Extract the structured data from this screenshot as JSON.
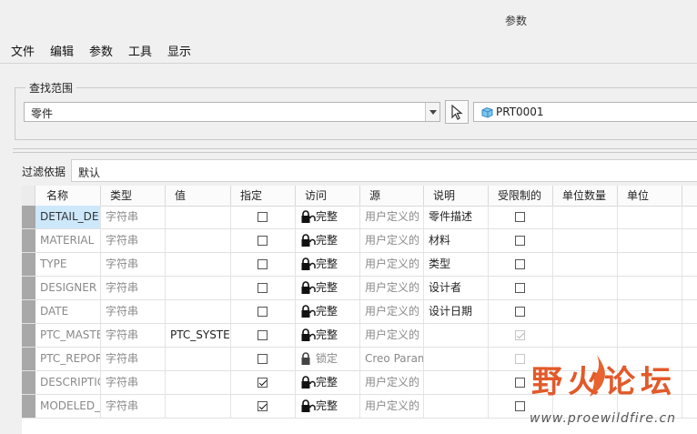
{
  "window": {
    "title": "参数"
  },
  "menu": [
    "文件",
    "编辑",
    "参数",
    "工具",
    "显示"
  ],
  "scope": {
    "group_label": "查找范围",
    "scope_value": "零件",
    "part_value": "PRT0001"
  },
  "filter": {
    "label": "过滤依据",
    "value": "默认"
  },
  "columns": [
    "名称",
    "类型",
    "值",
    "指定",
    "访问",
    "源",
    "说明",
    "受限制的",
    "单位数量",
    "单位"
  ],
  "rows": [
    {
      "name": "DETAIL_DE",
      "type": "字符串",
      "value": "",
      "designated": false,
      "access": "完整",
      "source": "用户定义的",
      "desc": "零件描述",
      "restricted": false,
      "restricted_disabled": false,
      "selected": true
    },
    {
      "name": "MATERIAL",
      "type": "字符串",
      "value": "",
      "designated": false,
      "access": "完整",
      "source": "用户定义的",
      "desc": "材料",
      "restricted": false,
      "restricted_disabled": false
    },
    {
      "name": "TYPE",
      "type": "字符串",
      "value": "",
      "designated": false,
      "access": "完整",
      "source": "用户定义的",
      "desc": "类型",
      "restricted": false,
      "restricted_disabled": false
    },
    {
      "name": "DESIGNER",
      "type": "字符串",
      "value": "",
      "designated": false,
      "access": "完整",
      "source": "用户定义的",
      "desc": "设计者",
      "restricted": false,
      "restricted_disabled": false
    },
    {
      "name": "DATE",
      "type": "字符串",
      "value": "",
      "designated": false,
      "access": "完整",
      "source": "用户定义的",
      "desc": "设计日期",
      "restricted": false,
      "restricted_disabled": false
    },
    {
      "name": "PTC_MASTE",
      "type": "字符串",
      "value": "PTC_SYSTEI",
      "designated": false,
      "access": "完整",
      "source": "用户定义的",
      "desc": "",
      "restricted": true,
      "restricted_disabled": true
    },
    {
      "name": "PTC_REPOR",
      "type": "字符串",
      "value": "",
      "designated": false,
      "access": "锁定",
      "source": "Creo Param",
      "desc": "",
      "restricted": false,
      "restricted_disabled": true
    },
    {
      "name": "DESCRIPTIC",
      "type": "字符串",
      "value": "",
      "designated": true,
      "access": "完整",
      "source": "用户定义的",
      "desc": "",
      "restricted": false,
      "restricted_disabled": false
    },
    {
      "name": "MODELED_",
      "type": "字符串",
      "value": "",
      "designated": true,
      "access": "完整",
      "source": "用户定义的",
      "desc": "",
      "restricted": false,
      "restricted_disabled": false
    }
  ],
  "watermark": {
    "text": "野火论坛",
    "url": "www.proewildfire.cn"
  },
  "colors": {
    "selection": "#cde8fb",
    "watermark": "#e25a2a"
  }
}
